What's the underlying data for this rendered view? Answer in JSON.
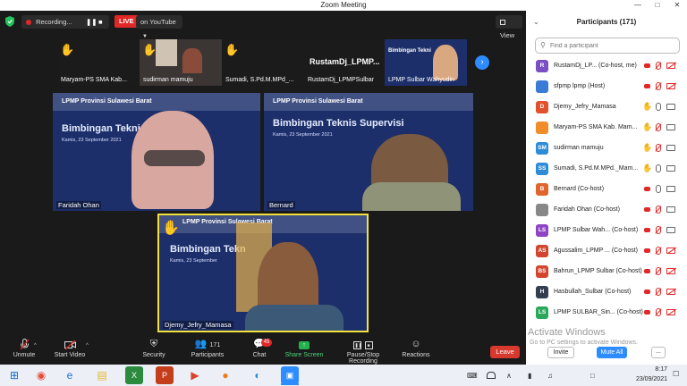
{
  "window": {
    "title": "Zoom Meeting"
  },
  "topbar": {
    "recording_label": "Recording...",
    "live_label": "LIVE",
    "live_target": "on YouTube",
    "view_label": "View"
  },
  "strip": [
    {
      "name": "Maryam-PS SMA Kab..."
    },
    {
      "name": "sudirman mamuju"
    },
    {
      "name": "Sumadi, S.Pd.M.MPd_..."
    },
    {
      "name": "RustamDj_LPMPSulbar",
      "big": "RustamDj_LPMP..."
    },
    {
      "name": "LPMP Sulbar Wahyudin"
    }
  ],
  "banner": {
    "org": "LPMP Provinsi Sulawesi Barat",
    "headline_left": "Bimbingan Tekni",
    "headline_right": "Bimbingan Teknis Supervisi",
    "headline_bottom": "Bimbingan Tekn",
    "date": "Kamis, 23 September 2021",
    "date_short": "Kamis, 23 September"
  },
  "tiles": {
    "left_name": "Faridah Ohan",
    "right_name": "Bernard",
    "bottom_name": "Djemy_Jefry_Mamasa"
  },
  "toolbar": {
    "unmute": "Unmute",
    "start_video": "Start Video",
    "security": "Security",
    "participants": "Participants",
    "participants_count": "171",
    "chat": "Chat",
    "chat_badge": "45",
    "share": "Share Screen",
    "pause_rec": "Pause/Stop Recording",
    "reactions": "Reactions",
    "leave": "Leave"
  },
  "panel": {
    "title": "Participants (171)",
    "search_placeholder": "Find a participant",
    "invite": "Invite",
    "mute_all": "Mute All",
    "more": "...",
    "participants": [
      {
        "initials": "R",
        "color": "#7b4fc4",
        "name": "RustamDj_LP... (Co-host, me)",
        "hand": false,
        "rec": true,
        "mic": "off",
        "cam": "off"
      },
      {
        "initials": "",
        "color": "#3a7bd5",
        "name": "sfpmp lpmp (Host)",
        "hand": false,
        "rec": true,
        "mic": "off",
        "cam": "off"
      },
      {
        "initials": "D",
        "color": "#e0512c",
        "name": "Djemy_Jefry_Mamasa",
        "hand": true,
        "rec": false,
        "mic": "on",
        "cam": "on"
      },
      {
        "initials": "",
        "color": "#f08c2a",
        "name": "Maryam-PS SMA Kab. Mam...",
        "hand": true,
        "rec": false,
        "mic": "off",
        "cam": "on"
      },
      {
        "initials": "SM",
        "color": "#2e8bd8",
        "name": "sudirman mamuju",
        "hand": true,
        "rec": false,
        "mic": "off",
        "cam": "on"
      },
      {
        "initials": "SS",
        "color": "#2e8bd8",
        "name": "Sumadi, S.Pd.M.MPd._Mam...",
        "hand": true,
        "rec": false,
        "mic": "on",
        "cam": "on"
      },
      {
        "initials": "B",
        "color": "#e0642c",
        "name": "Bernard (Co-host)",
        "hand": false,
        "rec": true,
        "mic": "on",
        "cam": "on"
      },
      {
        "initials": "",
        "color": "#888888",
        "name": "Faridah Ohan (Co-host)",
        "hand": false,
        "rec": true,
        "mic": "off",
        "cam": "on"
      },
      {
        "initials": "LS",
        "color": "#8e44c4",
        "name": "LPMP Sulbar Wah... (Co-host)",
        "hand": false,
        "rec": true,
        "mic": "off",
        "cam": "on"
      },
      {
        "initials": "AS",
        "color": "#d2452f",
        "name": "Agussalim_LPMP ... (Co-host)",
        "hand": false,
        "rec": true,
        "mic": "off",
        "cam": "off"
      },
      {
        "initials": "BS",
        "color": "#d2452f",
        "name": "Bahrun_LPMP Sulbar (Co-host)",
        "hand": false,
        "rec": true,
        "mic": "off",
        "cam": "off"
      },
      {
        "initials": "H",
        "color": "#333e4e",
        "name": "Hasbullah_Sulbar (Co-host)",
        "hand": false,
        "rec": true,
        "mic": "off",
        "cam": "off"
      },
      {
        "initials": "LS",
        "color": "#2aa85a",
        "name": "LPMP SULBAR_Sin... (Co-host)",
        "hand": false,
        "rec": true,
        "mic": "off",
        "cam": "off"
      }
    ]
  },
  "watermark": {
    "title": "Activate Windows",
    "subtitle": "Go to PC settings to activate Windows."
  },
  "taskbar": {
    "time": "8:17",
    "date": "23/09/2021"
  }
}
